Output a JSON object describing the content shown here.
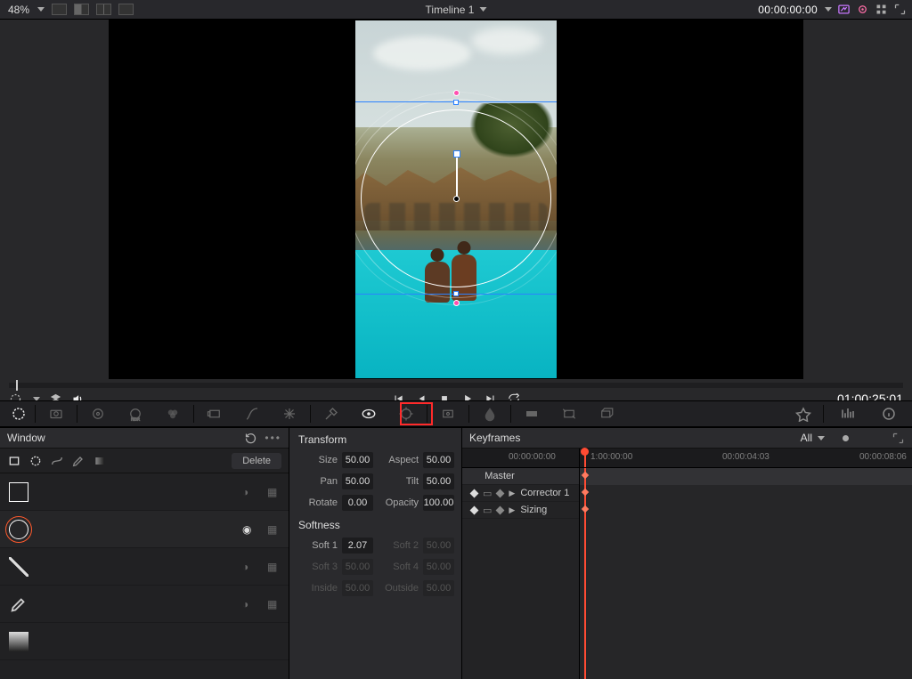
{
  "topbar": {
    "zoom": "48%",
    "timeline": "Timeline 1",
    "timecode": "00:00:00:00"
  },
  "viewer": {
    "source_tc": "01:00:25:01"
  },
  "palette": {
    "tools": [
      "adjust",
      "camera-raw",
      "color-match",
      "wheels",
      "hdr-wheels",
      "rgb-mixer",
      "motion",
      "curves",
      "warp",
      "desat",
      "qualifier",
      "window",
      "tracker",
      "magic",
      "blur",
      "key",
      "sizing",
      "3d"
    ],
    "highlighted": "window"
  },
  "window_panel": {
    "title": "Window",
    "delete": "Delete",
    "shapes": [
      "Linear",
      "Circle",
      "Polygon",
      "Curve",
      "Gradient"
    ]
  },
  "params": {
    "transform_title": "Transform",
    "size_lbl": "Size",
    "size": "50.00",
    "aspect_lbl": "Aspect",
    "aspect": "50.00",
    "pan_lbl": "Pan",
    "pan": "50.00",
    "tilt_lbl": "Tilt",
    "tilt": "50.00",
    "rotate_lbl": "Rotate",
    "rotate": "0.00",
    "opacity_lbl": "Opacity",
    "opacity": "100.00",
    "softness_title": "Softness",
    "soft1_lbl": "Soft 1",
    "soft1": "2.07",
    "soft2_lbl": "Soft 2",
    "soft2": "50.00",
    "soft3_lbl": "Soft 3",
    "soft3": "50.00",
    "soft4_lbl": "Soft 4",
    "soft4": "50.00",
    "inside_lbl": "Inside",
    "inside": "50.00",
    "outside_lbl": "Outside",
    "outside": "50.00"
  },
  "keyframes": {
    "title": "Keyframes",
    "filter": "All",
    "ruler": [
      "00:00:00:00",
      "1:00:00:00",
      "00:00:04:03",
      "00:00:08:06"
    ],
    "rows": {
      "master": "Master",
      "corrector": "Corrector 1",
      "sizing": "Sizing"
    }
  }
}
